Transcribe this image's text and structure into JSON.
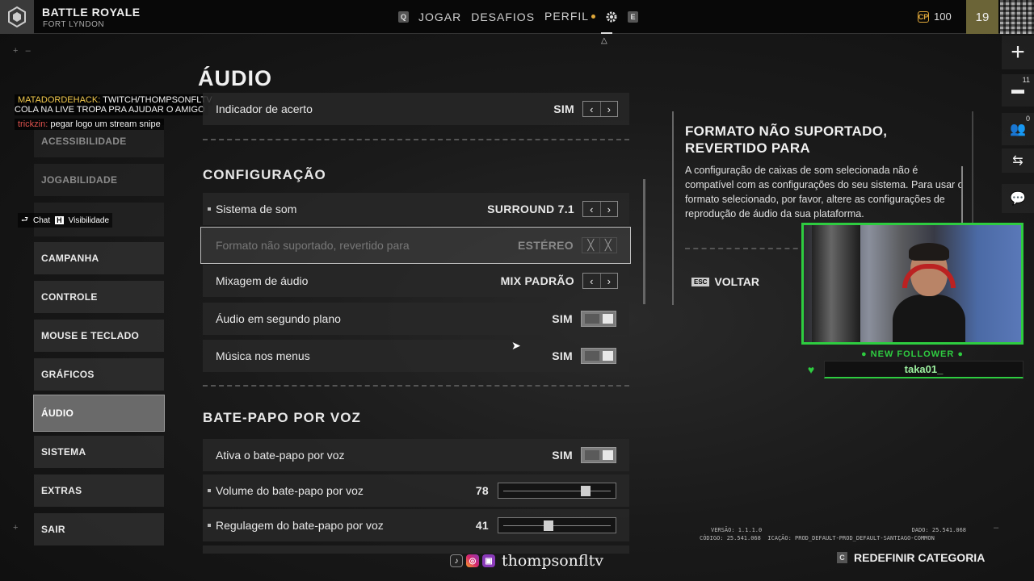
{
  "header": {
    "mode_title": "BATTLE ROYALE",
    "mode_subtitle": "FORT LYNDON",
    "key_left": "Q",
    "key_right": "E",
    "nav": [
      "JOGAR",
      "DESAFIOS",
      "PERFIL"
    ],
    "currency_icon": "CP",
    "currency": "100",
    "level": "19"
  },
  "page_title": "ÁUDIO",
  "sidebar": {
    "items": [
      "ACESSIBILIDADE",
      "JOGABILIDADE",
      "CAMPANHA",
      "CONTROLE",
      "MOUSE E TECLADO",
      "GRÁFICOS",
      "ÁUDIO",
      "SISTEMA",
      "EXTRAS",
      "SAIR"
    ],
    "active": "ÁUDIO"
  },
  "chat": {
    "line1_name": "MATADORDEHACK:",
    "line1_msg": "TWITCH/THOMPSONFLTV  COLA NA LIVE TROPA PRA AJUDAR O AMIGO",
    "line2_name": "trickzin:",
    "line2_msg": "pegar logo um stream snipe",
    "bar_key1": "Chat",
    "bar_key2": "H",
    "bar_label": "Visibilidade"
  },
  "settings": {
    "top_row": {
      "label": "Indicador de acerto",
      "value": "SIM"
    },
    "section_config": "CONFIGURAÇÃO",
    "rows": [
      {
        "label": "Sistema de som",
        "value": "SURROUND 7.1"
      },
      {
        "label": "Formato não suportado, revertido para",
        "value": "ESTÉREO"
      },
      {
        "label": "Mixagem de áudio",
        "value": "MIX PADRÃO"
      },
      {
        "label": "Áudio em segundo plano",
        "value": "SIM"
      },
      {
        "label": "Música nos menus",
        "value": "SIM"
      }
    ],
    "section_voice": "BATE-PAPO POR VOZ",
    "voice_rows": [
      {
        "label": "Ativa o bate-papo por voz",
        "value": "SIM"
      },
      {
        "label": "Volume do bate-papo por voz",
        "value": "78"
      },
      {
        "label": "Regulagem do bate-papo por voz",
        "value": "41"
      }
    ],
    "voice_volume": 78,
    "voice_threshold": 41
  },
  "info_panel": {
    "title": "FORMATO NÃO SUPORTADO, REVERTIDO PARA",
    "body": "A configuração de caixas de som selecionada não é compatível com as configurações do seu sistema. Para usar o formato selecionado, por favor, altere as configurações de reprodução de áudio da sua plataforma.",
    "back_key": "ESC",
    "back_label": "VOLTAR"
  },
  "rail": {
    "badge1": "11",
    "badge2": "0"
  },
  "stream": {
    "new_follower": "NEW FOLLOWER",
    "follower_name": "taka01_",
    "handle": "thompsonfltv"
  },
  "footer": {
    "version": "VERSÃO: 1.1.1.0",
    "code": "CÓDIGO: 25.541.068",
    "data": "DADO: 25.541.068",
    "config": "ICAÇÃO: PROD_DEFAULT-PROD_DEFAULT-SANTIAGO-COMMON",
    "reset_key": "C",
    "reset_label": "REDEFINIR CATEGORIA"
  },
  "colors": {
    "accent_green": "#2ecc40",
    "currency_gold": "#e0a83a",
    "chat_name": "#f2c94c"
  }
}
